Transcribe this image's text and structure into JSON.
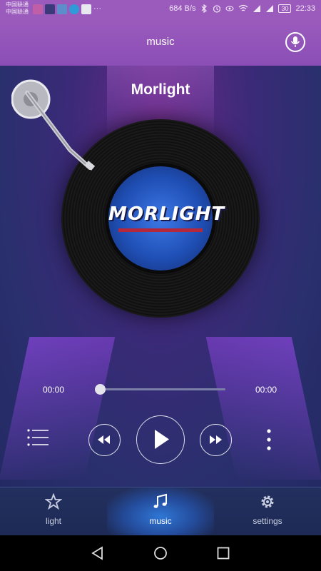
{
  "status_bar": {
    "carrier_1": "中国联通",
    "carrier_2": "中国联通",
    "overflow": "···",
    "net_speed": "684 B/s",
    "battery": "30",
    "time": "22:33"
  },
  "header": {
    "title": "music",
    "mic_icon": "microphone-icon"
  },
  "player": {
    "song_title": "Morlight",
    "album_logo": "MORLIGHT",
    "current_time": "00:00",
    "total_time": "00:00",
    "progress": 0,
    "playlist_icon": "playlist-icon",
    "rewind_icon": "rewind-icon",
    "play_icon": "play-icon",
    "forward_icon": "fast-forward-icon",
    "more_icon": "more-vertical-icon"
  },
  "nav": {
    "tabs": [
      {
        "label": "light",
        "icon": "star-icon",
        "active": false
      },
      {
        "label": "music",
        "icon": "music-note-icon",
        "active": true
      },
      {
        "label": "settings",
        "icon": "gear-icon",
        "active": false
      }
    ]
  },
  "colors": {
    "header": "#9b5bbd",
    "accent_blue": "#2f77d6",
    "logo_red": "#b5283b"
  }
}
